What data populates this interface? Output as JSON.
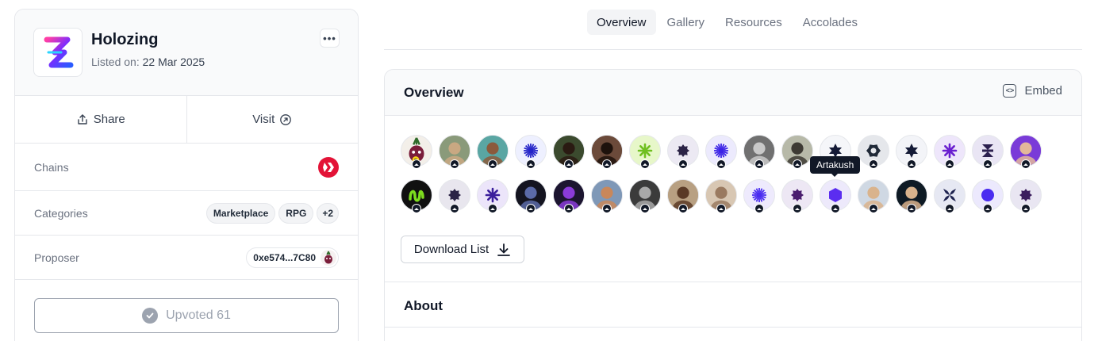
{
  "project": {
    "name": "Holozing",
    "listed_label": "Listed on:",
    "listed_date": "22 Mar 2025",
    "more_label": "•••"
  },
  "actions": {
    "share": "Share",
    "visit": "Visit"
  },
  "rows": {
    "chains_label": "Chains",
    "categories_label": "Categories",
    "categories": [
      "Marketplace",
      "RPG"
    ],
    "categories_more": "+2",
    "proposer_label": "Proposer",
    "proposer_address": "0xe574...7C80"
  },
  "upvote_label": "Upvoted 61",
  "tabs": [
    "Overview",
    "Gallery",
    "Resources",
    "Accolades"
  ],
  "active_tab": "Overview",
  "overview": {
    "title": "Overview",
    "embed_label": "Embed",
    "tooltip": "Artakush",
    "download_label": "Download List",
    "about_title": "About"
  },
  "avatars": {
    "row1": [
      {
        "kind": "photo",
        "bg": "#f3efe9",
        "fg": "#7a1d3a",
        "icon": "beet-mascot-icon"
      },
      {
        "kind": "photo",
        "bg": "#8a9a7a",
        "fg": "#c9a882",
        "icon": "person-photo-icon"
      },
      {
        "kind": "photo",
        "bg": "#5aa6a3",
        "fg": "#8b5a3c",
        "icon": "person-photo-icon"
      },
      {
        "kind": "glyph",
        "bg": "#eef0ff",
        "fg": "#2323c8",
        "icon": "sunburst-icon"
      },
      {
        "kind": "photo",
        "bg": "#3b4a2e",
        "fg": "#2a1a12",
        "icon": "person-photo-icon"
      },
      {
        "kind": "photo",
        "bg": "#6b4a3a",
        "fg": "#1e120c",
        "icon": "person-photo-icon"
      },
      {
        "kind": "glyph",
        "bg": "#e7f7c9",
        "fg": "#6fbf1f",
        "icon": "asterisk-icon"
      },
      {
        "kind": "glyph",
        "bg": "#ece9f3",
        "fg": "#2b2346",
        "icon": "gear-blob-icon"
      },
      {
        "kind": "glyph",
        "bg": "#eceafd",
        "fg": "#3a22e6",
        "icon": "sunburst-icon"
      },
      {
        "kind": "photo",
        "bg": "#707070",
        "fg": "#c8c8c8",
        "icon": "person-photo-icon"
      },
      {
        "kind": "photo",
        "bg": "#b7b9a8",
        "fg": "#3d3a33",
        "icon": "person-photo-icon"
      },
      {
        "kind": "glyph",
        "bg": "#f5f6f9",
        "fg": "#141a36",
        "icon": "star-six-icon"
      },
      {
        "kind": "glyph",
        "bg": "#e5e7eb",
        "fg": "#1f2937",
        "icon": "gear-icon"
      },
      {
        "kind": "glyph",
        "bg": "#f3f4f8",
        "fg": "#141a36",
        "icon": "star-six-icon"
      },
      {
        "kind": "glyph",
        "bg": "#eee6fb",
        "fg": "#6a1fd0",
        "icon": "asterisk-icon"
      },
      {
        "kind": "glyph",
        "bg": "#e9e5f4",
        "fg": "#2b1f4e",
        "icon": "hourglass-icon"
      },
      {
        "kind": "photo",
        "bg": "#7a3bd8",
        "fg": "#e3b89a",
        "icon": "person-photo-icon"
      }
    ],
    "row2": [
      {
        "kind": "glyph",
        "bg": "#101010",
        "fg": "#7ddc1e",
        "icon": "squiggle-icon"
      },
      {
        "kind": "glyph",
        "bg": "#e8e6ee",
        "fg": "#2b2346",
        "icon": "gear-blob-icon"
      },
      {
        "kind": "glyph",
        "bg": "#ece5fa",
        "fg": "#3b1e9c",
        "icon": "asterisk-icon"
      },
      {
        "kind": "photo",
        "bg": "#141420",
        "fg": "#5b6aa8",
        "icon": "person-photo-icon"
      },
      {
        "kind": "photo",
        "bg": "#1c1530",
        "fg": "#8a3bd8",
        "icon": "person-photo-icon"
      },
      {
        "kind": "photo",
        "bg": "#7f98b7",
        "fg": "#c9875a",
        "icon": "person-photo-icon"
      },
      {
        "kind": "photo",
        "bg": "#3b3b3b",
        "fg": "#a9a9a9",
        "icon": "person-photo-icon"
      },
      {
        "kind": "photo",
        "bg": "#b8a082",
        "fg": "#5a3a26",
        "icon": "person-photo-icon"
      },
      {
        "kind": "photo",
        "bg": "#d8c7b3",
        "fg": "#9a7a60",
        "icon": "person-photo-icon"
      },
      {
        "kind": "glyph",
        "bg": "#eeeafd",
        "fg": "#4a2cf0",
        "icon": "sunburst-icon"
      },
      {
        "kind": "glyph",
        "bg": "#ede7f4",
        "fg": "#4a1e6e",
        "icon": "gear-blob-icon"
      },
      {
        "kind": "glyph",
        "bg": "#ede9fb",
        "fg": "#5b2df0",
        "icon": "hexagon-icon"
      },
      {
        "kind": "photo",
        "bg": "#cfd8e3",
        "fg": "#d9b38c",
        "icon": "person-photo-icon"
      },
      {
        "kind": "photo",
        "bg": "#0e1a24",
        "fg": "#d8b28c",
        "icon": "person-photo-icon"
      },
      {
        "kind": "glyph",
        "bg": "#e6e8f3",
        "fg": "#1e2350",
        "icon": "petal-x-icon"
      },
      {
        "kind": "glyph",
        "bg": "#ece9fd",
        "fg": "#4a2cf0",
        "icon": "circle-icon"
      },
      {
        "kind": "glyph",
        "bg": "#e9e6f2",
        "fg": "#3b1e5e",
        "icon": "gear-blob-icon"
      }
    ]
  }
}
